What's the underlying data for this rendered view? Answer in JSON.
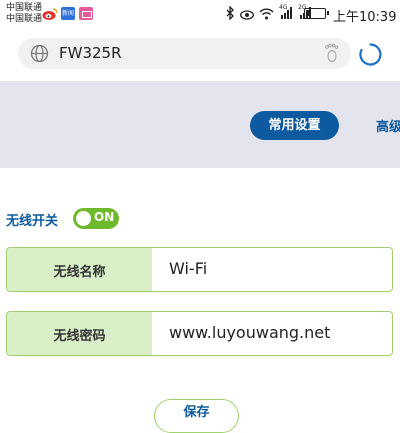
{
  "status_bar": {
    "carrier_1": "中国联通",
    "carrier_2": "中国联通",
    "news_app_text": "新闻",
    "network_1": "4G",
    "network_2": "2G",
    "time": "上午10:39"
  },
  "url_bar": {
    "url": "FW325R"
  },
  "nav": {
    "tab_common": "常用设置",
    "tab_advanced": "高级"
  },
  "wifi": {
    "switch_label": "无线开关",
    "switch_state": "ON",
    "name_label": "无线名称",
    "name_value": "Wi-Fi",
    "password_label": "无线密码",
    "password_value": "www.luyouwang.net",
    "save_label": "保存"
  },
  "colors": {
    "accent_blue": "#0d5aa0",
    "toggle_green": "#6fba2c",
    "field_border": "#9fd26a",
    "label_bg": "#d9efc7",
    "nav_band": "#e4e4ef"
  }
}
